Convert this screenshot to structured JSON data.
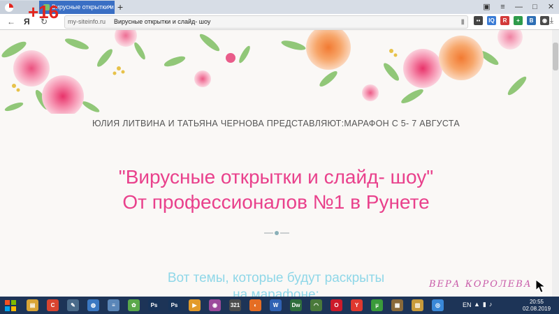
{
  "counter_badge": "+16",
  "tabs": {
    "active_title": "Вирусные открытки и сл",
    "close_glyph": "×",
    "new_tab_glyph": "+"
  },
  "address_bar": {
    "domain": "my-siteinfo.ru",
    "page_title": "Вирусные открытки и слайд- шоу",
    "browser_logo_letter": "Я"
  },
  "extensions": [
    {
      "name": "menu-ext",
      "label": "▪▪",
      "color": "#444444"
    },
    {
      "name": "iq-ext",
      "label": "IQ",
      "color": "#3a7bd5"
    },
    {
      "name": "red-ext",
      "label": "R",
      "color": "#d23a3a"
    },
    {
      "name": "green-ext",
      "label": "+",
      "color": "#2e9b4b"
    },
    {
      "name": "blue-ext",
      "label": "B",
      "color": "#2f6fb5"
    },
    {
      "name": "round-ext",
      "label": "◉",
      "color": "#4a4a4a"
    }
  ],
  "page": {
    "subtitle": "ЮЛИЯ ЛИТВИНА И ТАТЬЯНА ЧЕРНОВА ПРЕДСТАВЛЯЮТ:МАРАФОН С 5- 7 АВГУСТА",
    "headline_line1": "\"Вирусные открытки и слайд- шоу\"",
    "headline_line2": "От профессионалов №1 в Рунете",
    "topics_line1": "Вот темы, которые будут раскрыты",
    "topics_line2": "на марафоне:",
    "watermark": "ВЕРА КОРОЛЕВА"
  },
  "colors": {
    "headline": "#e9418c",
    "topics": "#8fd7e8",
    "accent_tab": "#3a6fc4",
    "taskbar": "#1d3457"
  },
  "taskbar": {
    "language": "EN",
    "time": "20:55",
    "date": "02.08.2019",
    "apps": [
      {
        "name": "folder-app",
        "label": "▤",
        "color": "#d9a436"
      },
      {
        "name": "red-app",
        "label": "C",
        "color": "#d94430"
      },
      {
        "name": "tool-app",
        "label": "✎",
        "color": "#4a6b8a"
      },
      {
        "name": "globe-app",
        "label": "◍",
        "color": "#3b78c2"
      },
      {
        "name": "notes-app",
        "label": "≡",
        "color": "#5a86b8"
      },
      {
        "name": "paint-app",
        "label": "✿",
        "color": "#5aa84a"
      },
      {
        "name": "ps-app-1",
        "label": "Ps",
        "color": "#17345a"
      },
      {
        "name": "ps-app-2",
        "label": "Ps",
        "color": "#17345a"
      },
      {
        "name": "play-app",
        "label": "▶",
        "color": "#e29a2a"
      },
      {
        "name": "media-app",
        "label": "◉",
        "color": "#9c4a9c"
      },
      {
        "name": "calendar-app",
        "label": "321",
        "color": "#4c4c4c"
      },
      {
        "name": "firefox-app",
        "label": "◐",
        "color": "#e56d23"
      },
      {
        "name": "word-app",
        "label": "W",
        "color": "#2f62b4"
      },
      {
        "name": "dw-app",
        "label": "Dw",
        "color": "#2f6e3c"
      },
      {
        "name": "wifi-app",
        "label": "◠",
        "color": "#4a7a3a"
      },
      {
        "name": "opera-app",
        "label": "O",
        "color": "#cc1a2a"
      },
      {
        "name": "yandex-app",
        "label": "Y",
        "color": "#e0392f"
      },
      {
        "name": "torrent-app",
        "label": "µ",
        "color": "#3a9b3a"
      },
      {
        "name": "archive-app",
        "label": "▦",
        "color": "#8a6a3a"
      },
      {
        "name": "explorer-app",
        "label": "▥",
        "color": "#c89b3a"
      },
      {
        "name": "chrome-app",
        "label": "◎",
        "color": "#3a88d8"
      }
    ]
  }
}
